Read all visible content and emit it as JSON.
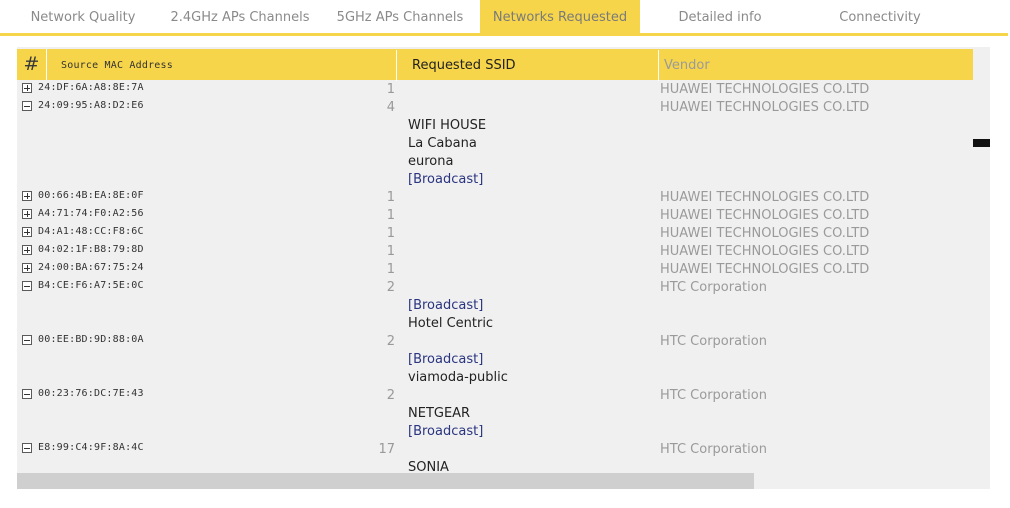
{
  "tabs": [
    {
      "label": "Network Quality"
    },
    {
      "label": "2.4GHz APs Channels"
    },
    {
      "label": "5GHz APs Channels"
    },
    {
      "label": "Networks Requested"
    },
    {
      "label": "Detailed info"
    },
    {
      "label": "Connectivity"
    }
  ],
  "active_tab": "Networks Requested",
  "table": {
    "headers": {
      "mac": "Source MAC Address",
      "count": "#",
      "ssid": "Requested SSID",
      "vendor": "Vendor"
    },
    "rows": [
      {
        "type": "device",
        "expanded": false,
        "mac": "24:DF:6A:A8:8E:7A",
        "count": "1",
        "vendor": "HUAWEI TECHNOLOGIES CO.LTD"
      },
      {
        "type": "device",
        "expanded": true,
        "mac": "24:09:95:A8:D2:E6",
        "count": "4",
        "vendor": "HUAWEI TECHNOLOGIES CO.LTD"
      },
      {
        "type": "ssid",
        "ssid": "WIFI HOUSE"
      },
      {
        "type": "ssid",
        "ssid": "La Cabana"
      },
      {
        "type": "ssid",
        "ssid": "eurona"
      },
      {
        "type": "ssid",
        "ssid": "[Broadcast]",
        "broadcast": true
      },
      {
        "type": "device",
        "expanded": false,
        "mac": "00:66:4B:EA:8E:0F",
        "count": "1",
        "vendor": "HUAWEI TECHNOLOGIES CO.LTD"
      },
      {
        "type": "device",
        "expanded": false,
        "mac": "A4:71:74:F0:A2:56",
        "count": "1",
        "vendor": "HUAWEI TECHNOLOGIES CO.LTD"
      },
      {
        "type": "device",
        "expanded": false,
        "mac": "D4:A1:48:CC:F8:6C",
        "count": "1",
        "vendor": "HUAWEI TECHNOLOGIES CO.LTD"
      },
      {
        "type": "device",
        "expanded": false,
        "mac": "04:02:1F:B8:79:8D",
        "count": "1",
        "vendor": "HUAWEI TECHNOLOGIES CO.LTD"
      },
      {
        "type": "device",
        "expanded": false,
        "mac": "24:00:BA:67:75:24",
        "count": "1",
        "vendor": "HUAWEI TECHNOLOGIES CO.LTD"
      },
      {
        "type": "device",
        "expanded": true,
        "mac": "B4:CE:F6:A7:5E:0C",
        "count": "2",
        "vendor": "HTC Corporation"
      },
      {
        "type": "ssid",
        "ssid": "[Broadcast]",
        "broadcast": true
      },
      {
        "type": "ssid",
        "ssid": "Hotel Centric"
      },
      {
        "type": "device",
        "expanded": true,
        "mac": "00:EE:BD:9D:88:0A",
        "count": "2",
        "vendor": "HTC Corporation"
      },
      {
        "type": "ssid",
        "ssid": "[Broadcast]",
        "broadcast": true
      },
      {
        "type": "ssid",
        "ssid": "viamoda-public"
      },
      {
        "type": "device",
        "expanded": true,
        "mac": "00:23:76:DC:7E:43",
        "count": "2",
        "vendor": "HTC Corporation"
      },
      {
        "type": "ssid",
        "ssid": "NETGEAR"
      },
      {
        "type": "ssid",
        "ssid": "[Broadcast]",
        "broadcast": true
      },
      {
        "type": "device",
        "expanded": true,
        "mac": "E8:99:C4:9F:8A:4C",
        "count": "17",
        "vendor": "HTC Corporation"
      },
      {
        "type": "ssid",
        "ssid": "SONIA"
      }
    ]
  },
  "colors": {
    "accent": "#f7d54a",
    "panel_bg": "#f0f0f0",
    "broadcast_text": "#2a3580",
    "vendor_text": "#9a9a9a"
  }
}
